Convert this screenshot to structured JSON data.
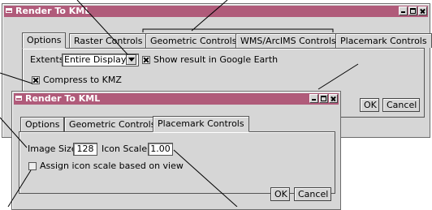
{
  "back_window": {
    "title": "Render To KML",
    "tabs": [
      "Options",
      "Raster Controls",
      "Geometric Controls",
      "WMS/ArcIMS Controls",
      "Placemark Controls"
    ],
    "extents_label": "Extents",
    "extents_value": "Entire Display",
    "show_result_label": "Show result in Google Earth",
    "show_result_checked": true,
    "compress_label": "Compress to KMZ",
    "compress_checked": true,
    "ok_label": "OK",
    "cancel_label": "Cancel"
  },
  "front_window": {
    "title": "Render To KML",
    "tabs": [
      "Options",
      "Geometric Controls",
      "Placemark Controls"
    ],
    "image_size_label": "Image Size",
    "image_size_value": "128",
    "icon_scale_label": "Icon Scale",
    "icon_scale_value": "1.00",
    "assign_label": "Assign icon scale based on view",
    "assign_checked": false,
    "ok_label": "OK",
    "cancel_label": "Cancel"
  },
  "colors": {
    "titlebar": "#b05b7a",
    "window_face": "#d6d6d6",
    "callout_line": "#000000"
  },
  "icons": [
    "window-menu-icon",
    "minimize-icon",
    "maximize-icon",
    "close-icon",
    "dropdown-arrow-icon",
    "checkbox-icon"
  ]
}
